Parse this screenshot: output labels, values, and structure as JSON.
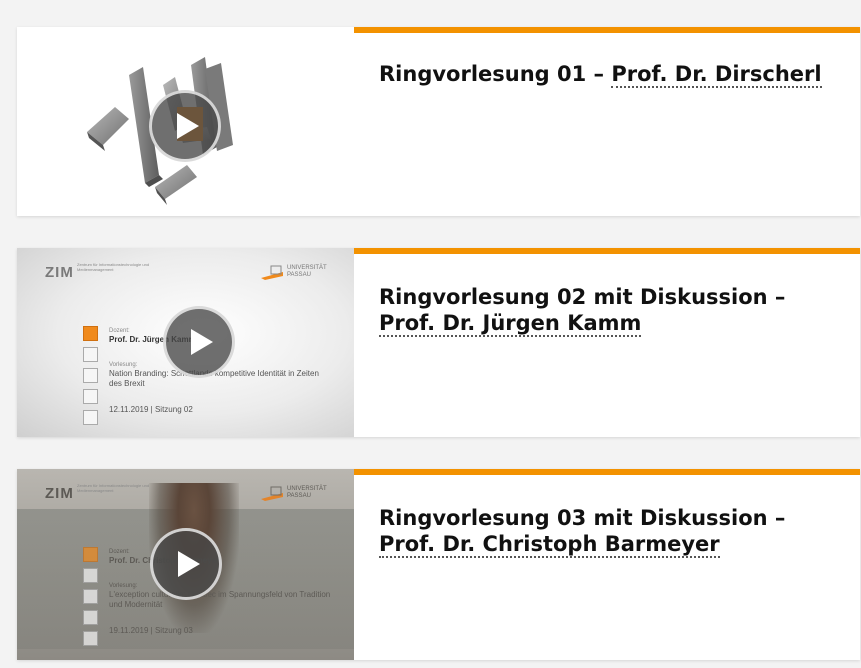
{
  "accent_color": "#f39200",
  "videos": [
    {
      "title_prefix": "Ringvorlesung 01 – ",
      "title_link": "Prof. Dr. Dirscherl",
      "thumbnail": "abstract-3d-logo",
      "play_icon": "play-icon"
    },
    {
      "title_prefix": "Ringvorlesung 02 mit Diskussion – ",
      "title_link": "Prof. Dr. Jürgen Kamm",
      "thumbnail": "lecture-title-slide",
      "play_icon": "play-icon",
      "slide": {
        "zim": "ZIM",
        "zim_sub": "Zentrum für Informationstechnologie und Medienmanagement",
        "uni": "UNIVERSITÄT PASSAU",
        "dozent_label": "Dozent:",
        "dozent": "Prof. Dr. Jürgen Kamm",
        "vorlesung_label": "Vorlesung:",
        "topic": "Nation Branding: Schottlands kompetitive Identität in Zeiten des Brexit",
        "date": "12.11.2019 | Sitzung 02"
      }
    },
    {
      "title_prefix": "Ringvorlesung 03 mit Diskussion – ",
      "title_link": "Prof. Dr. Christoph Barmeyer",
      "thumbnail": "lecture-video-frame",
      "play_icon": "play-icon",
      "slide": {
        "zim": "ZIM",
        "zim_sub": "Zentrum für Informationstechnologie und Medienmanagement",
        "uni": "UNIVERSITÄT PASSAU",
        "dozent_label": "Dozent:",
        "dozent": "Prof. Dr. Christoph Barmeyer",
        "vorlesung_label": "Vorlesung:",
        "topic": "L'exception culturelle: Québec im Spannungsfeld von Tradition und Modernität",
        "date": "19.11.2019 | Sitzung 03"
      }
    }
  ]
}
